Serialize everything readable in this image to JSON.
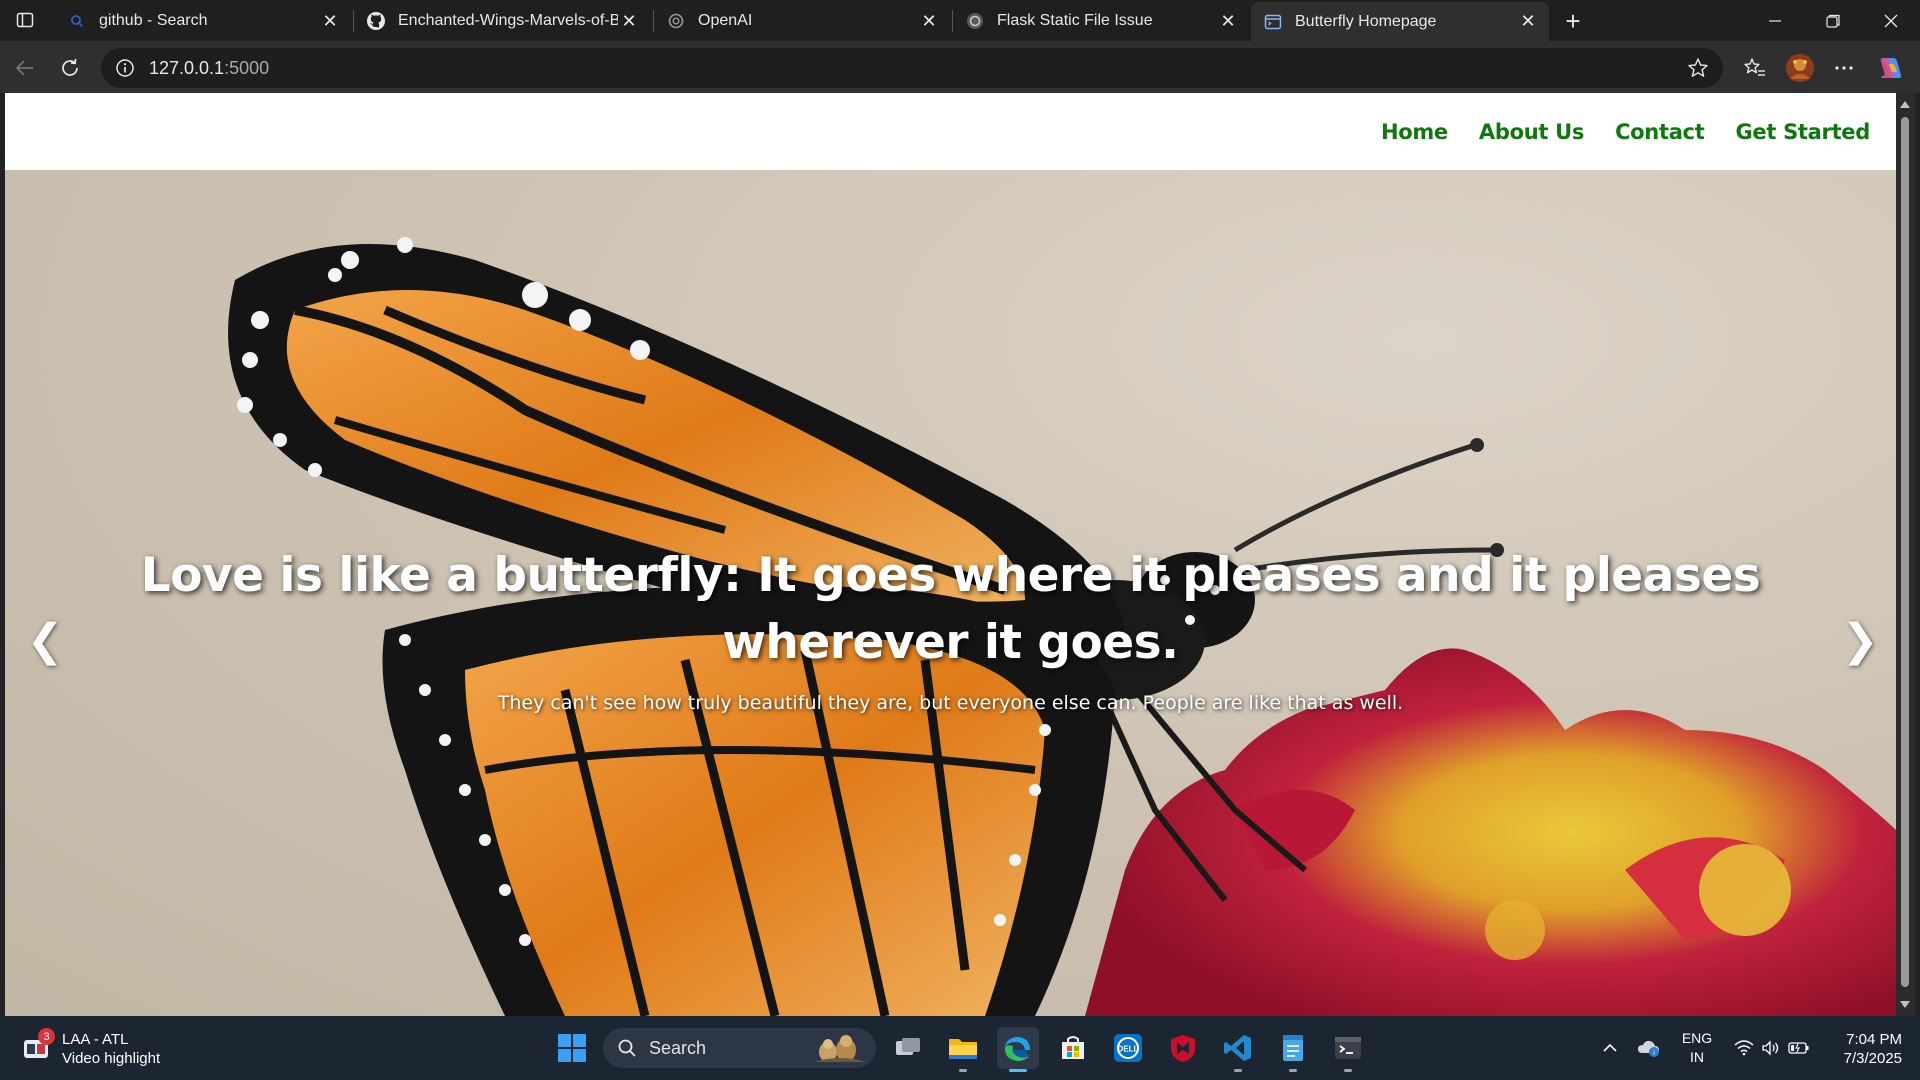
{
  "browser": {
    "tabs": [
      {
        "title": "github - Search",
        "icon": "bing-search-icon",
        "active": false
      },
      {
        "title": "Enchanted-Wings-Marvels-of-But",
        "icon": "github-icon",
        "active": false
      },
      {
        "title": "OpenAI",
        "icon": "openai-icon",
        "active": false
      },
      {
        "title": "Flask Static File Issue",
        "icon": "openai-icon",
        "active": false
      },
      {
        "title": "Butterfly Homepage",
        "icon": "page-icon",
        "active": true
      }
    ],
    "address": {
      "host": "127.0.0.1",
      "port": ":5000"
    }
  },
  "site": {
    "nav": [
      "Home",
      "About Us",
      "Contact",
      "Get Started"
    ],
    "hero": {
      "heading": "Love is like a butterfly: It goes where it pleases and it pleases wherever it goes.",
      "subtext": "They can't see how truly beautiful they are, but everyone else can. People are like that as well.",
      "prev_arrow": "❮",
      "next_arrow": "❯"
    }
  },
  "taskbar": {
    "widget": {
      "title": "LAA - ATL",
      "subtitle": "Video highlight",
      "badge": "3"
    },
    "search_label": "Search",
    "language": {
      "line1": "ENG",
      "line2": "IN"
    },
    "time": "7:04 PM",
    "date": "7/3/2025"
  },
  "colors": {
    "nav_link": "#0b7a0b",
    "taskbar_bg": "#1c2633",
    "tab_strip_bg": "#1f1f1f"
  }
}
